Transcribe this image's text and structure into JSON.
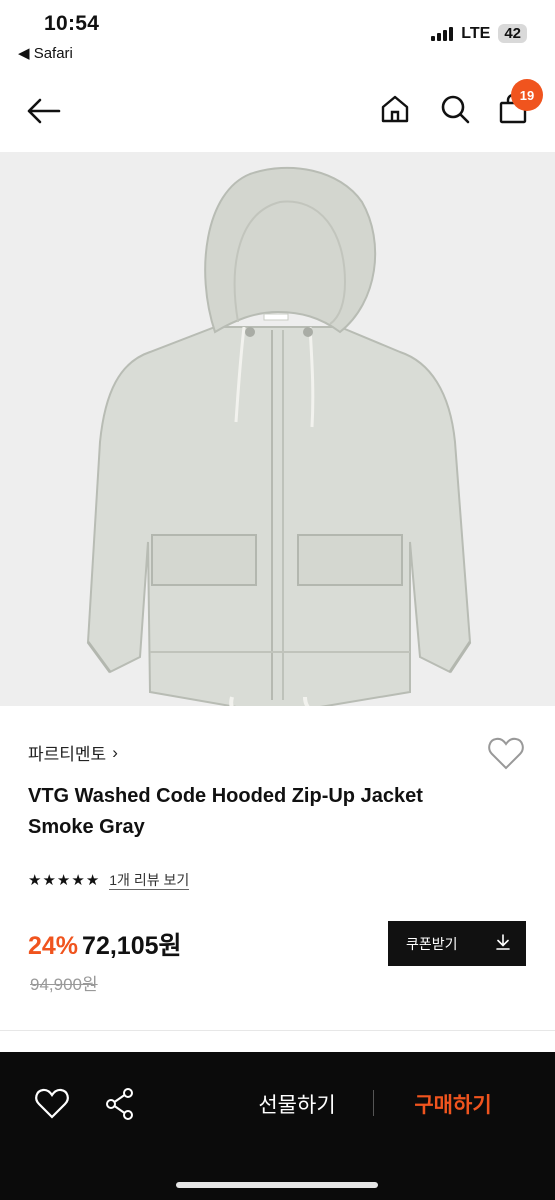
{
  "status_bar": {
    "time": "10:54",
    "back_app": "◀ Safari",
    "network": "LTE",
    "battery": "42"
  },
  "header": {
    "cart_count": "19",
    "icons": [
      "back-arrow-icon",
      "home-icon",
      "search-icon",
      "cart-icon"
    ]
  },
  "product": {
    "brand": "파르티멘토",
    "brand_chevron": "›",
    "title": "VTG Washed Code Hooded Zip-Up Jacket Smoke Gray",
    "stars": [
      "★",
      "★",
      "★",
      "★",
      "★"
    ],
    "review_link": "1개 리뷰 보기",
    "discount": "24%",
    "price": "72,105원",
    "original_price": "94,900원",
    "image_desc": "smoke gray hooded zip-up jacket"
  },
  "coupon": {
    "label": "쿠폰받기"
  },
  "bottom_bar": {
    "gift_label": "선물하기",
    "buy_label": "구매하기"
  },
  "colors": {
    "accent": "#f0541e",
    "dark": "#0b0b0b",
    "image_bg": "#eeeeee",
    "jacket": "#d9dcd6"
  }
}
